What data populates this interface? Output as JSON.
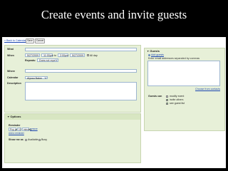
{
  "slide": {
    "title": "Create events and invite guests"
  },
  "toolbar": {
    "back_label": "« Back to Calendar",
    "save_label": "Save",
    "cancel_label": "Cancel"
  },
  "form": {
    "what_label": "What",
    "when_label": "When",
    "start_date": "5/27/2009",
    "start_time": "11:00pm",
    "to_label": "to",
    "end_time": "2:00pm",
    "end_date": "5/27/2009",
    "all_day_label": "All day",
    "repeats_label": "Repeats:",
    "repeats_value": "Does not repeat",
    "where_label": "Where",
    "calendar_label": "Calendar",
    "calendar_value": "Alyssa Baker",
    "description_label": "Description"
  },
  "guests": {
    "header": "Guests",
    "add_label": "Add guests",
    "hint": "Enter email addresses separated by commas",
    "choose_link": "Choose from contacts",
    "can_label": "Guests can",
    "permissions": [
      {
        "label": "modify event",
        "checked": false
      },
      {
        "label": "invite others",
        "checked": true
      },
      {
        "label": "see guest list",
        "checked": true
      }
    ]
  },
  "options": {
    "header": "Options",
    "reminder_label": "Reminder",
    "reminder_method": "Pop-up",
    "reminder_amount": "10",
    "reminder_unit": "minutes",
    "remove_link": "remove",
    "add_reminder_link": "Add a reminder",
    "show_label": "Show me as",
    "available_label": "Available",
    "busy_label": "Busy",
    "show_value": "Busy"
  }
}
